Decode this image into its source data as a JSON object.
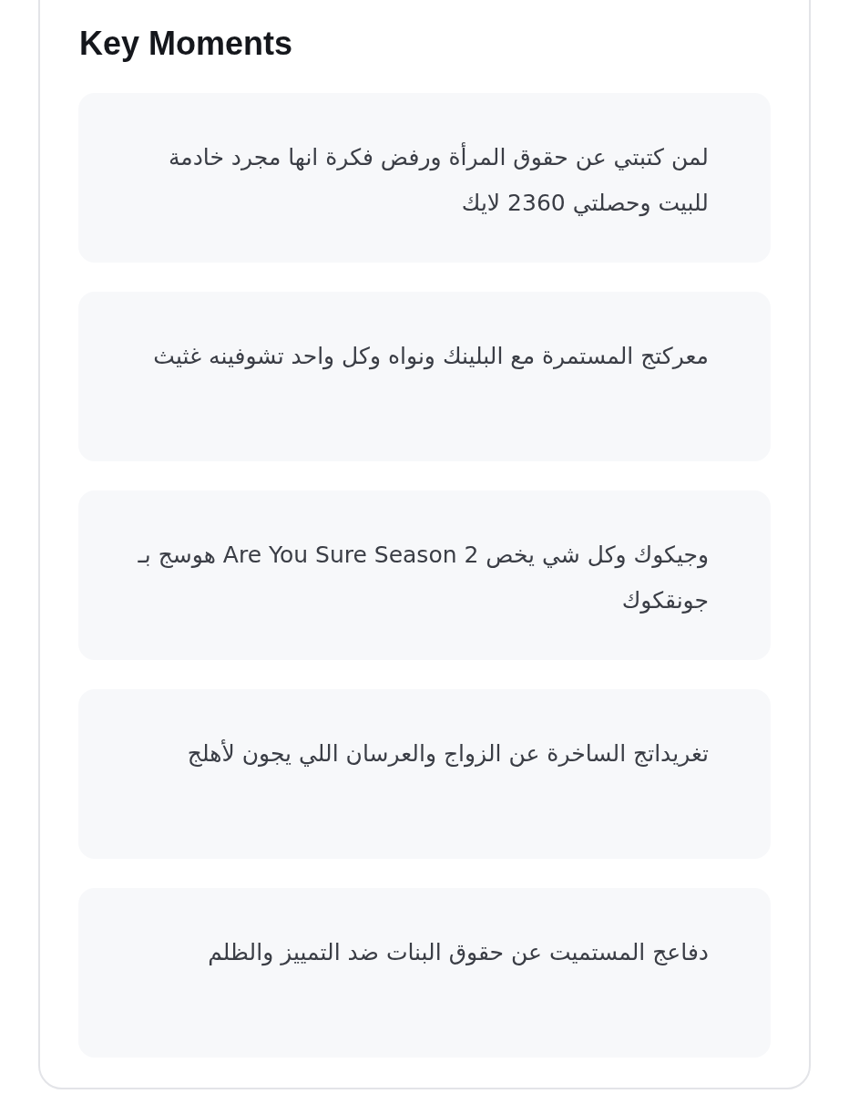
{
  "title": "Key Moments",
  "moments": [
    {
      "text": "لمن كتبتي عن حقوق المرأة ورفض فكرة انها مجرد خادمة للبيت وحصلتي 2360 لايك"
    },
    {
      "text": "معركتج المستمرة مع البلينك ونواه وكل واحد تشوفينه غثيث"
    },
    {
      "text": "هوسج بـ Are You Sure Season 2 وجيكوك وكل شي يخص جونقكوك"
    },
    {
      "text": "تغريداتج الساخرة عن الزواج والعرسان اللي يجون لأهلج"
    },
    {
      "text": "دفاعج المستميت عن حقوق البنات ضد التمييز والظلم"
    }
  ]
}
